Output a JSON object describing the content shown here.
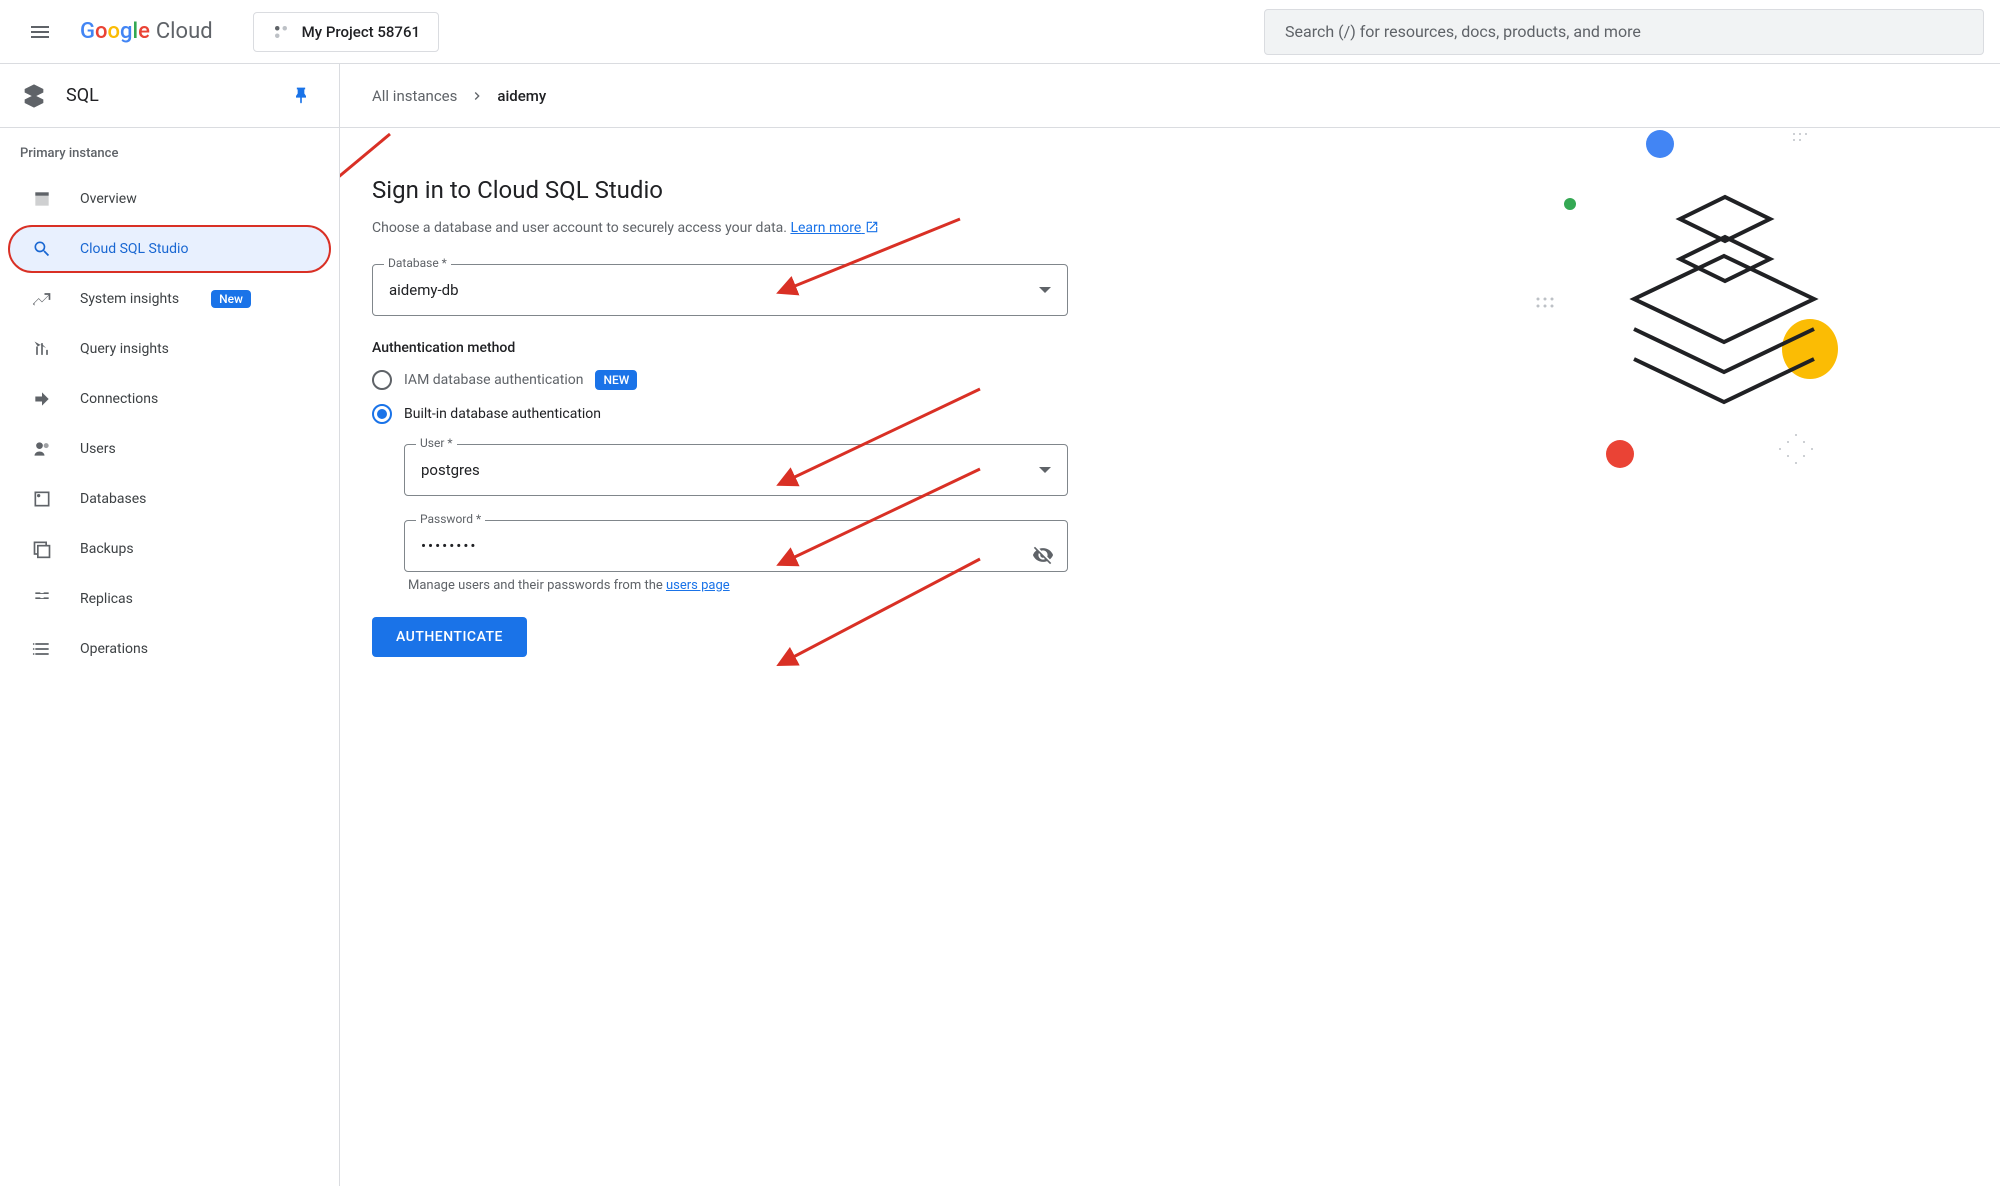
{
  "header": {
    "brand": "Cloud",
    "project": "My Project 58761",
    "search_placeholder": "Search (/) for resources, docs, products, and more"
  },
  "sidebar": {
    "title": "SQL",
    "section": "Primary instance",
    "items": [
      {
        "label": "Overview"
      },
      {
        "label": "Cloud SQL Studio"
      },
      {
        "label": "System insights",
        "badge": "New"
      },
      {
        "label": "Query insights"
      },
      {
        "label": "Connections"
      },
      {
        "label": "Users"
      },
      {
        "label": "Databases"
      },
      {
        "label": "Backups"
      },
      {
        "label": "Replicas"
      },
      {
        "label": "Operations"
      }
    ]
  },
  "breadcrumb": {
    "root": "All instances",
    "current": "aidemy"
  },
  "form": {
    "title": "Sign in to Cloud SQL Studio",
    "subtitle_pre": "Choose a database and user account to securely access your data. ",
    "learn_more": "Learn more",
    "database_label": "Database *",
    "database_value": "aidemy-db",
    "auth_method_label": "Authentication method",
    "auth_iam": "IAM database authentication",
    "auth_iam_badge": "NEW",
    "auth_builtin": "Built-in database authentication",
    "user_label": "User *",
    "user_value": "postgres",
    "password_label": "Password *",
    "password_value": "••••••••",
    "hint_pre": "Manage users and their passwords from the ",
    "hint_link": "users page",
    "submit": "AUTHENTICATE"
  }
}
